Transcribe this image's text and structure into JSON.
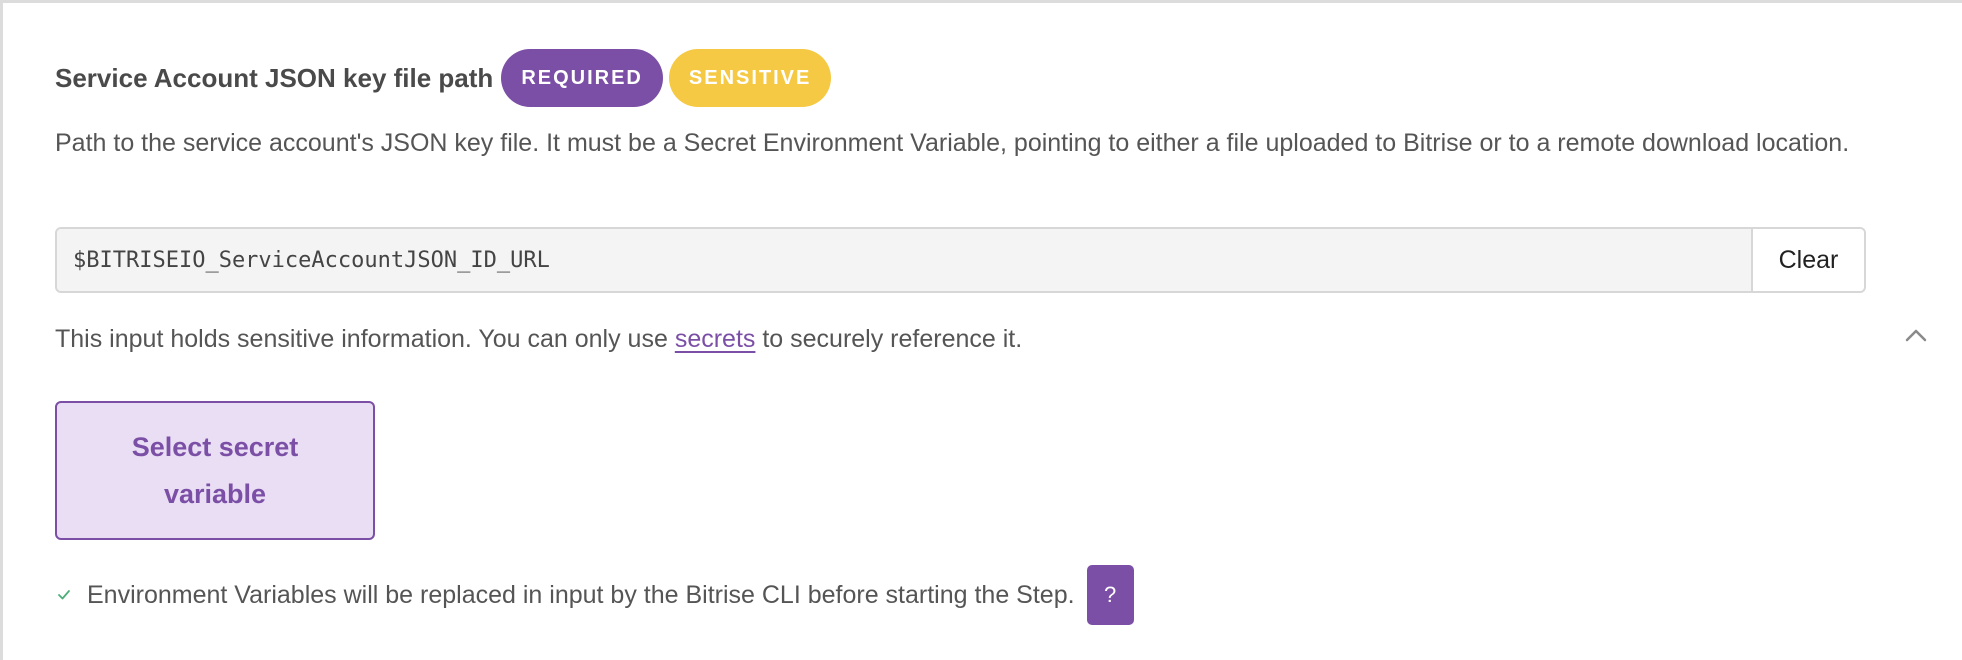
{
  "field": {
    "title": "Service Account JSON key file path",
    "badges": {
      "required": "REQUIRED",
      "sensitive": "SENSITIVE"
    },
    "description": "Path to the service account's JSON key file. It must be a Secret Environment Variable, pointing to either a file uploaded to Bitrise or to a remote download location.",
    "input_value": "$BITRISEIO_ServiceAccountJSON_ID_URL",
    "clear_label": "Clear"
  },
  "sensitive_note": {
    "prefix": "This input holds sensitive information. You can only use ",
    "link": "secrets",
    "suffix": " to securely reference it."
  },
  "select_secret_label": "Select secret variable",
  "footer": {
    "text": "Environment Variables will be replaced in input by the Bitrise CLI before starting the Step.",
    "help_label": "?"
  },
  "icons": {
    "collapse": "chevron-up-icon",
    "check": "check-icon"
  },
  "colors": {
    "accent": "#7b4fa6",
    "sensitive": "#f6c944",
    "select_bg": "#e9def4",
    "check": "#4caf7a"
  }
}
